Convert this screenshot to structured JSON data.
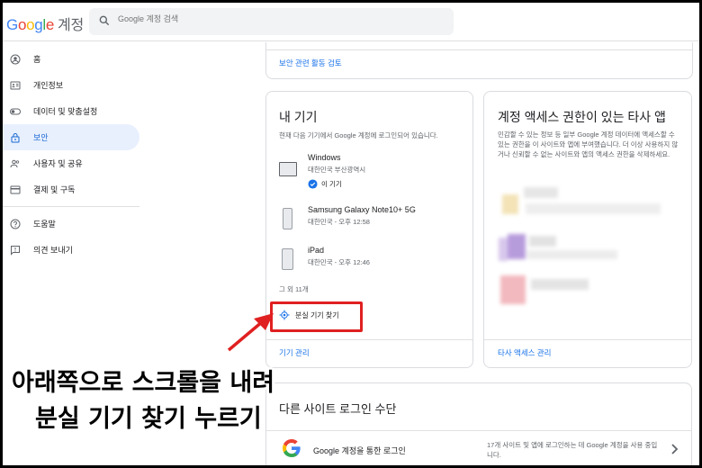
{
  "app": {
    "logo": "Google",
    "logo_suffix": "계정"
  },
  "search": {
    "placeholder": "Google 계정 검색"
  },
  "sidebar": {
    "items": [
      {
        "label": "홈"
      },
      {
        "label": "개인정보"
      },
      {
        "label": "데이터 및 맞춤설정"
      },
      {
        "label": "보안"
      },
      {
        "label": "사용자 및 공유"
      },
      {
        "label": "결제 및 구독"
      },
      {
        "label": "도움말"
      },
      {
        "label": "의견 보내기"
      }
    ]
  },
  "security_review": {
    "link": "보안 관련 활동 검토"
  },
  "my_devices": {
    "title": "내 기기",
    "description": "현재 다음 기기에서 Google 계정에 로그인되어 있습니다.",
    "devices": [
      {
        "name": "Windows",
        "location": "대한민국 부산광역시",
        "badge": "이 기기"
      },
      {
        "name": "Samsung Galaxy Note10+ 5G",
        "location": "대한민국 - 오후 12:58"
      },
      {
        "name": "iPad",
        "location": "대한민국 - 오후 12:46"
      }
    ],
    "more": "그 외 11개",
    "find_button": "분실 기기 찾기",
    "manage_link": "기기 관리"
  },
  "third_party": {
    "title": "계정 액세스 권한이 있는 타사 앱",
    "description": "민감할 수 있는 정보 등 일부 Google 계정 데이터에 액세스할 수 있는 권한을 이 사이트와 앱에 부여했습니다. 더 이상 사용하지 않거나 신뢰할 수 없는 사이트와 앱의 액세스 권한을 삭제하세요.",
    "manage_link": "타사 액세스 관리"
  },
  "other_signin": {
    "title": "다른 사이트 로그인 수단",
    "google_signin": "Google 계정을 통한 로그인",
    "google_signin_desc": "17개 사이트 및 앱에 로그인하는 데 Google 계정을 사용 중입니다."
  },
  "overlay": {
    "line1": "아래쪽으로 스크롤을 내려",
    "line2": "분실 기기 찾기 누르기"
  },
  "colors": {
    "accent": "#1a73e8",
    "selected_bg": "#e8f0fe",
    "highlight": "#e02020",
    "verified": "#1a73e8"
  }
}
